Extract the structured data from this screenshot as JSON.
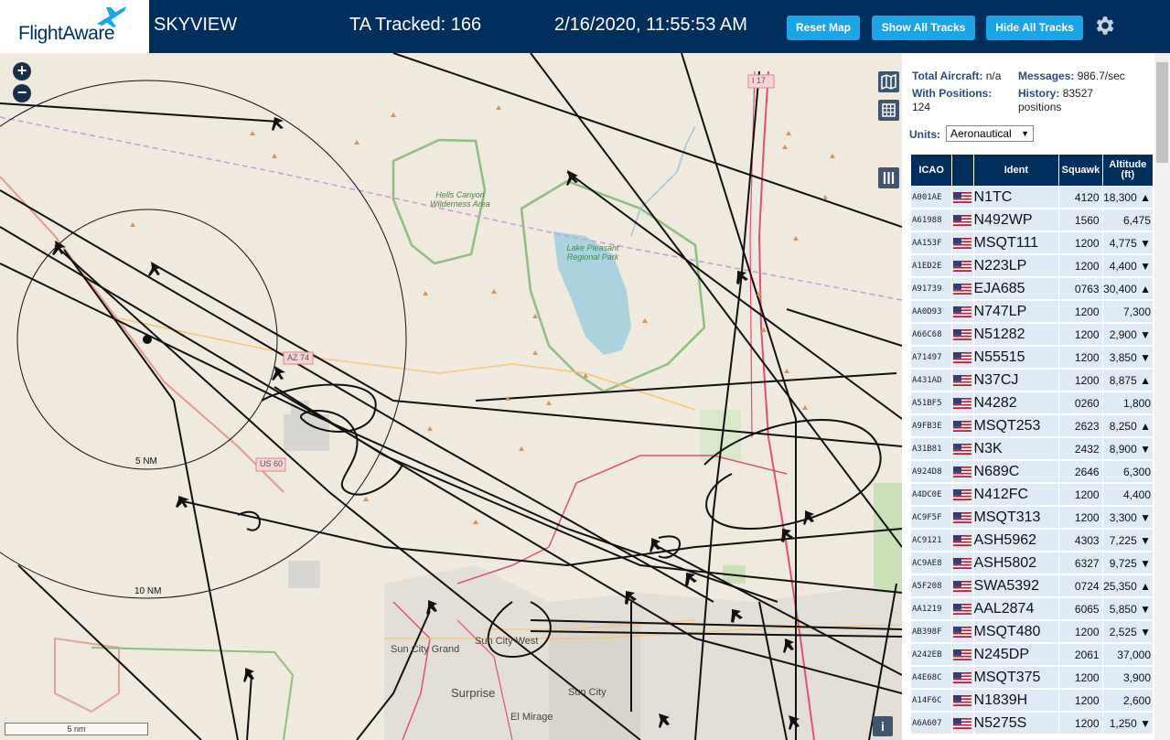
{
  "header": {
    "logo_text": "FlightAware",
    "app_name": "SKYVIEW",
    "tracked": "TA Tracked: 166",
    "datetime": "2/16/2020, 11:55:53 AM",
    "reset_label": "Reset Map",
    "show_label": "Show All Tracks",
    "hide_label": "Hide All Tracks",
    "gear_icon": "gear-icon",
    "brand_color": "#002f5d",
    "button_color": "#1ca5e6"
  },
  "map": {
    "zoom_in": "+",
    "zoom_out": "−",
    "ring_inner": "5 NM",
    "ring_outer": "10 NM",
    "scale": "5 nm",
    "info": "i",
    "labels": {
      "hells_canyon": "Hells Canyon Wilderness Area",
      "lake_pleasant": "Lake Pleasant Regional Park",
      "az74": "AZ 74",
      "us60": "US 60",
      "i17": "I 17",
      "sun_city_grand": "Sun City Grand",
      "sun_city_west": "Sun City West",
      "sun_city": "Sun City",
      "surprise": "Surprise",
      "el_mirage": "El Mirage"
    }
  },
  "sidebar": {
    "total_label": "Total Aircraft:",
    "total_value": "n/a",
    "messages_label": "Messages:",
    "messages_value": "986.7/sec",
    "positions_label": "With Positions:",
    "positions_value": "124",
    "history_label": "History:",
    "history_value": "83527",
    "history_unit": "positions",
    "units_label": "Units:",
    "units_value": "Aeronautical",
    "columns": [
      "ICAO",
      "",
      "Ident",
      "Squawk",
      "Altitude (ft)"
    ],
    "rows": [
      {
        "icao": "A001AE",
        "ident": "N1TC",
        "squawk": "4120",
        "alt": "18,300 ▲"
      },
      {
        "icao": "A61988",
        "ident": "N492WP",
        "squawk": "1560",
        "alt": "6,475"
      },
      {
        "icao": "AA153F",
        "ident": "MSQT111",
        "squawk": "1200",
        "alt": "4,775 ▼"
      },
      {
        "icao": "A1ED2E",
        "ident": "N223LP",
        "squawk": "1200",
        "alt": "4,400 ▼"
      },
      {
        "icao": "A91739",
        "ident": "EJA685",
        "squawk": "0763",
        "alt": "30,400 ▲"
      },
      {
        "icao": "AA0D93",
        "ident": "N747LP",
        "squawk": "1200",
        "alt": "7,300"
      },
      {
        "icao": "A66C68",
        "ident": "N51282",
        "squawk": "1200",
        "alt": "2,900 ▼"
      },
      {
        "icao": "A71497",
        "ident": "N55515",
        "squawk": "1200",
        "alt": "3,850 ▼"
      },
      {
        "icao": "A431AD",
        "ident": "N37CJ",
        "squawk": "1200",
        "alt": "8,875 ▲"
      },
      {
        "icao": "A51BF5",
        "ident": "N4282",
        "squawk": "0260",
        "alt": "1,800"
      },
      {
        "icao": "A9FB3E",
        "ident": "MSQT253",
        "squawk": "2623",
        "alt": "8,250 ▲"
      },
      {
        "icao": "A31B81",
        "ident": "N3K",
        "squawk": "2432",
        "alt": "8,900 ▼"
      },
      {
        "icao": "A924D8",
        "ident": "N689C",
        "squawk": "2646",
        "alt": "6,300"
      },
      {
        "icao": "A4DC0E",
        "ident": "N412FC",
        "squawk": "1200",
        "alt": "4,400"
      },
      {
        "icao": "AC9F5F",
        "ident": "MSQT313",
        "squawk": "1200",
        "alt": "3,300 ▼"
      },
      {
        "icao": "AC9121",
        "ident": "ASH5962",
        "squawk": "4303",
        "alt": "7,225 ▼"
      },
      {
        "icao": "AC9AE8",
        "ident": "ASH5802",
        "squawk": "6327",
        "alt": "9,725 ▼"
      },
      {
        "icao": "A5F208",
        "ident": "SWA5392",
        "squawk": "0724",
        "alt": "25,350 ▲"
      },
      {
        "icao": "AA1219",
        "ident": "AAL2874",
        "squawk": "6065",
        "alt": "5,850 ▼"
      },
      {
        "icao": "AB398F",
        "ident": "MSQT480",
        "squawk": "1200",
        "alt": "2,525 ▼"
      },
      {
        "icao": "A242EB",
        "ident": "N245DP",
        "squawk": "2061",
        "alt": "37,000"
      },
      {
        "icao": "A4E68C",
        "ident": "MSQT375",
        "squawk": "1200",
        "alt": "3,900"
      },
      {
        "icao": "A14F6C",
        "ident": "N1839H",
        "squawk": "1200",
        "alt": "2,600"
      },
      {
        "icao": "A6A607",
        "ident": "N5275S",
        "squawk": "1200",
        "alt": "1,250 ▼"
      }
    ]
  }
}
